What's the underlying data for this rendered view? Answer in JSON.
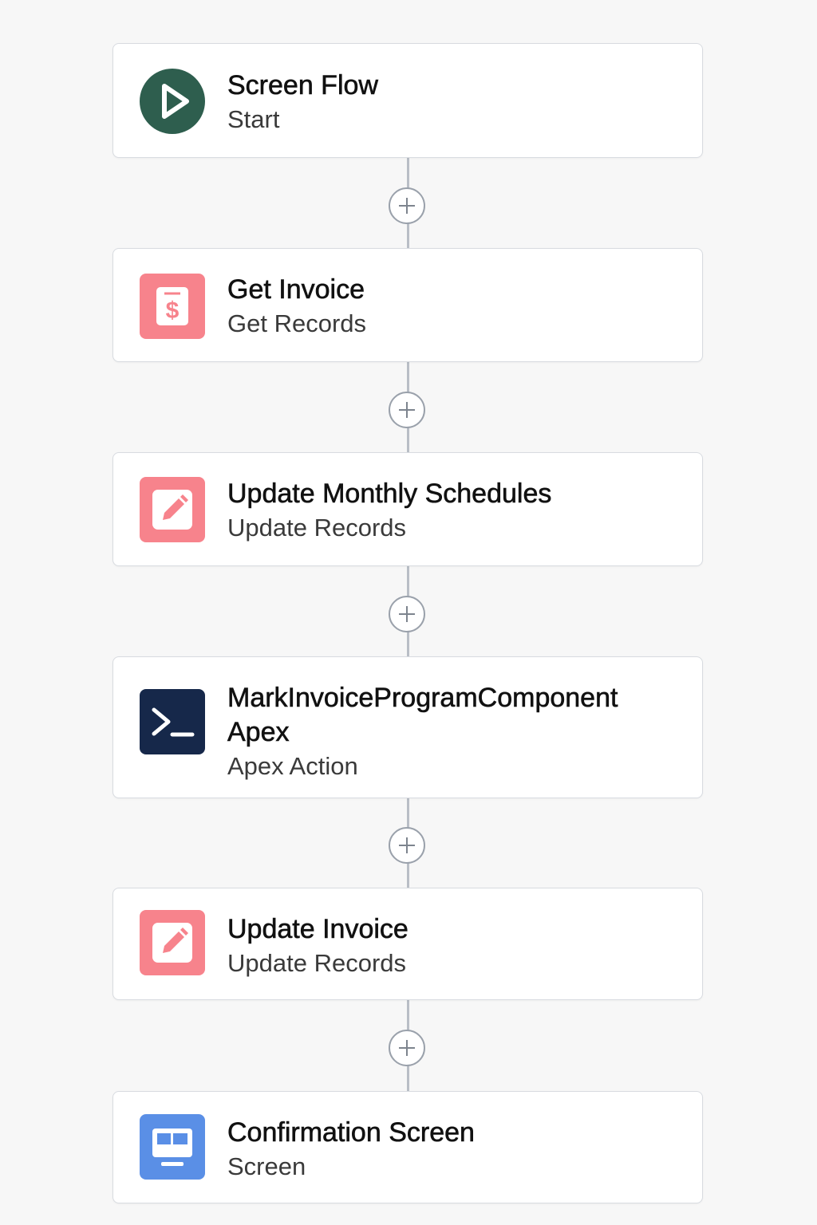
{
  "colors": {
    "start_icon_bg": "#2e5e4e",
    "record_icon_bg": "#f7838c",
    "apex_icon_bg": "#16284a",
    "screen_icon_bg": "#5a8fe6",
    "connector": "#b9bec6"
  },
  "flow": {
    "nodes": [
      {
        "title": "Screen Flow",
        "subtitle": "Start",
        "icon": "play-icon"
      },
      {
        "title": "Get Invoice",
        "subtitle": "Get Records",
        "icon": "dollar-document-icon"
      },
      {
        "title": "Update Monthly Schedules",
        "subtitle": "Update Records",
        "icon": "edit-icon"
      },
      {
        "title": "MarkInvoiceProgramComponent Apex",
        "subtitle": "Apex Action",
        "icon": "apex-terminal-icon"
      },
      {
        "title": "Update Invoice",
        "subtitle": "Update Records",
        "icon": "edit-icon"
      },
      {
        "title": "Confirmation Screen",
        "subtitle": "Screen",
        "icon": "screen-icon"
      }
    ],
    "add_element_icon": "plus-icon"
  }
}
